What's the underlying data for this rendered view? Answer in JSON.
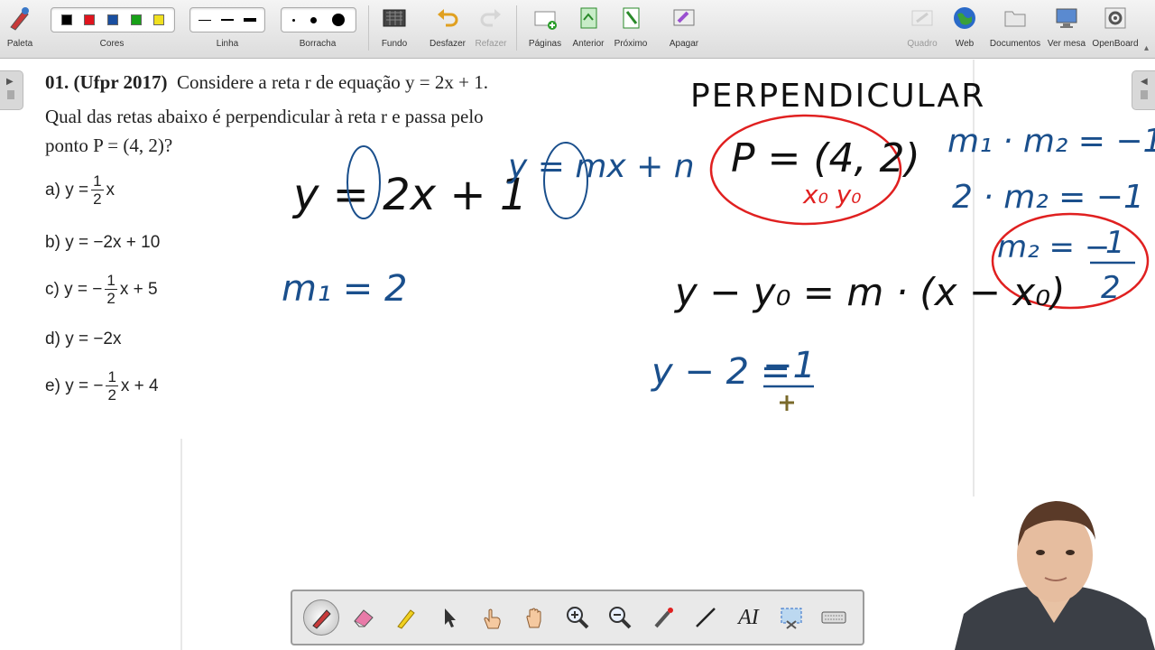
{
  "toolbar": {
    "paleta": "Paleta",
    "cores": "Cores",
    "linha": "Linha",
    "borracha": "Borracha",
    "fundo": "Fundo",
    "desfazer": "Desfazer",
    "refazer": "Refazer",
    "paginas": "Páginas",
    "anterior": "Anterior",
    "proximo": "Próximo",
    "apagar": "Apagar",
    "quadro": "Quadro",
    "web": "Web",
    "documentos": "Documentos",
    "ver_mesa": "Ver mesa",
    "openboard": "OpenBoard",
    "colors": [
      "#000000",
      "#e0141e",
      "#1a4fa0",
      "#18a018",
      "#f0e020"
    ]
  },
  "question": {
    "number": "01. (Ufpr 2017)",
    "line1_rest": "Considere a reta  r  de equação  y = 2x + 1.",
    "line2": "Qual das retas abaixo é perpendicular à reta  r  e passa pelo",
    "line3": "ponto  P = (4, 2)?",
    "options": {
      "a_label": "a)",
      "a_pre": "y =",
      "a_num": "1",
      "a_den": "2",
      "a_post": "x",
      "b_label": "b)",
      "b_text": "y = −2x + 10",
      "c_label": "c)",
      "c_pre": "y = −",
      "c_num": "1",
      "c_den": "2",
      "c_post": "x + 5",
      "d_label": "d)",
      "d_text": "y = −2x",
      "e_label": "e)",
      "e_pre": "y = −",
      "e_num": "1",
      "e_den": "2",
      "e_post": "x + 4"
    }
  },
  "handwriting": {
    "eq_r": "y = 2x + 1",
    "eq_general": "y = mx + n",
    "m1": "m₁ = 2",
    "perpendicular": "PERPENDICULAR",
    "point": "P = (4, 2)",
    "point_labels": "x₀  y₀",
    "product": "m₁ · m₂ = −1",
    "product_sub": "2 · m₂ = −1",
    "m2_lhs": "m₂ = −",
    "m2_num": "1",
    "m2_den": "2",
    "point_slope": "y − y₀ = m · (x − x₀)",
    "partial_lhs": "y − 2 = ",
    "partial_num": "−1"
  },
  "colors": {
    "ink_black": "#111111",
    "ink_blue": "#1a4f8c",
    "ink_red": "#e02020"
  }
}
